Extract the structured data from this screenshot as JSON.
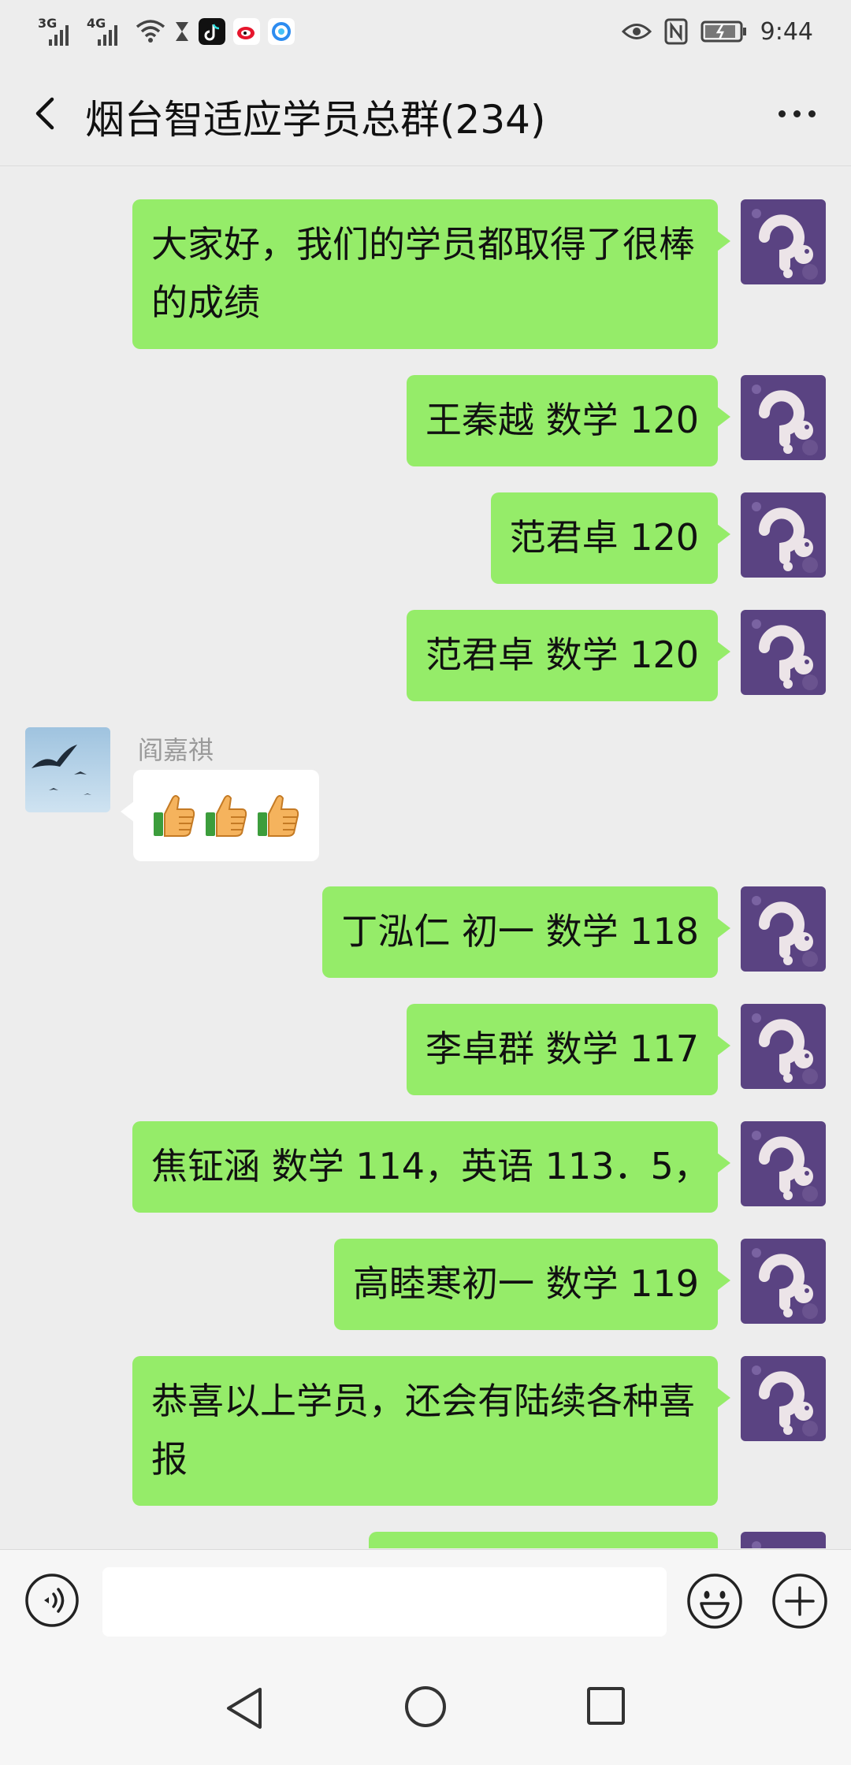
{
  "status_bar": {
    "signal1": "3G",
    "signal2": "4G",
    "time": "9:44",
    "icons": [
      "wifi-icon",
      "hourglass-icon",
      "tiktok-icon",
      "weibo-icon",
      "app-icon",
      "eye-icon",
      "nfc-icon",
      "battery-icon"
    ]
  },
  "header": {
    "title": "烟台智适应学员总群(234)",
    "back_icon": "chevron-left-icon",
    "more_icon": "more-dots-icon"
  },
  "messages": [
    {
      "side": "right",
      "text": "大家好，我们的学员都取得了很棒的成绩"
    },
    {
      "side": "right",
      "text": "王秦越 数学 120"
    },
    {
      "side": "right",
      "text": "范君卓 120"
    },
    {
      "side": "right",
      "text": "范君卓 数学 120"
    },
    {
      "side": "left",
      "sender": "阎嘉祺",
      "content": "thumbs-up x3"
    },
    {
      "side": "right",
      "text": "丁泓仁 初一 数学 118"
    },
    {
      "side": "right",
      "text": "李卓群 数学 117"
    },
    {
      "side": "right",
      "text": "焦钲涵 数学 114，英语 113．5，"
    },
    {
      "side": "right",
      "text": "高睦寒初一 数学 119"
    },
    {
      "side": "right",
      "text": "恭喜以上学员，还会有陆续各种喜报"
    }
  ],
  "input_bar": {
    "voice_icon": "voice-icon",
    "input_value": "",
    "emoji_icon": "emoji-icon",
    "plus_icon": "plus-icon"
  },
  "nav_bar": {
    "icons": [
      "nav-back-icon",
      "nav-home-icon",
      "nav-recent-icon"
    ]
  },
  "colors": {
    "background": "#ededed",
    "my_bubble": "#95ec69",
    "other_bubble": "#ffffff",
    "sender_name": "#9a9a9a"
  }
}
